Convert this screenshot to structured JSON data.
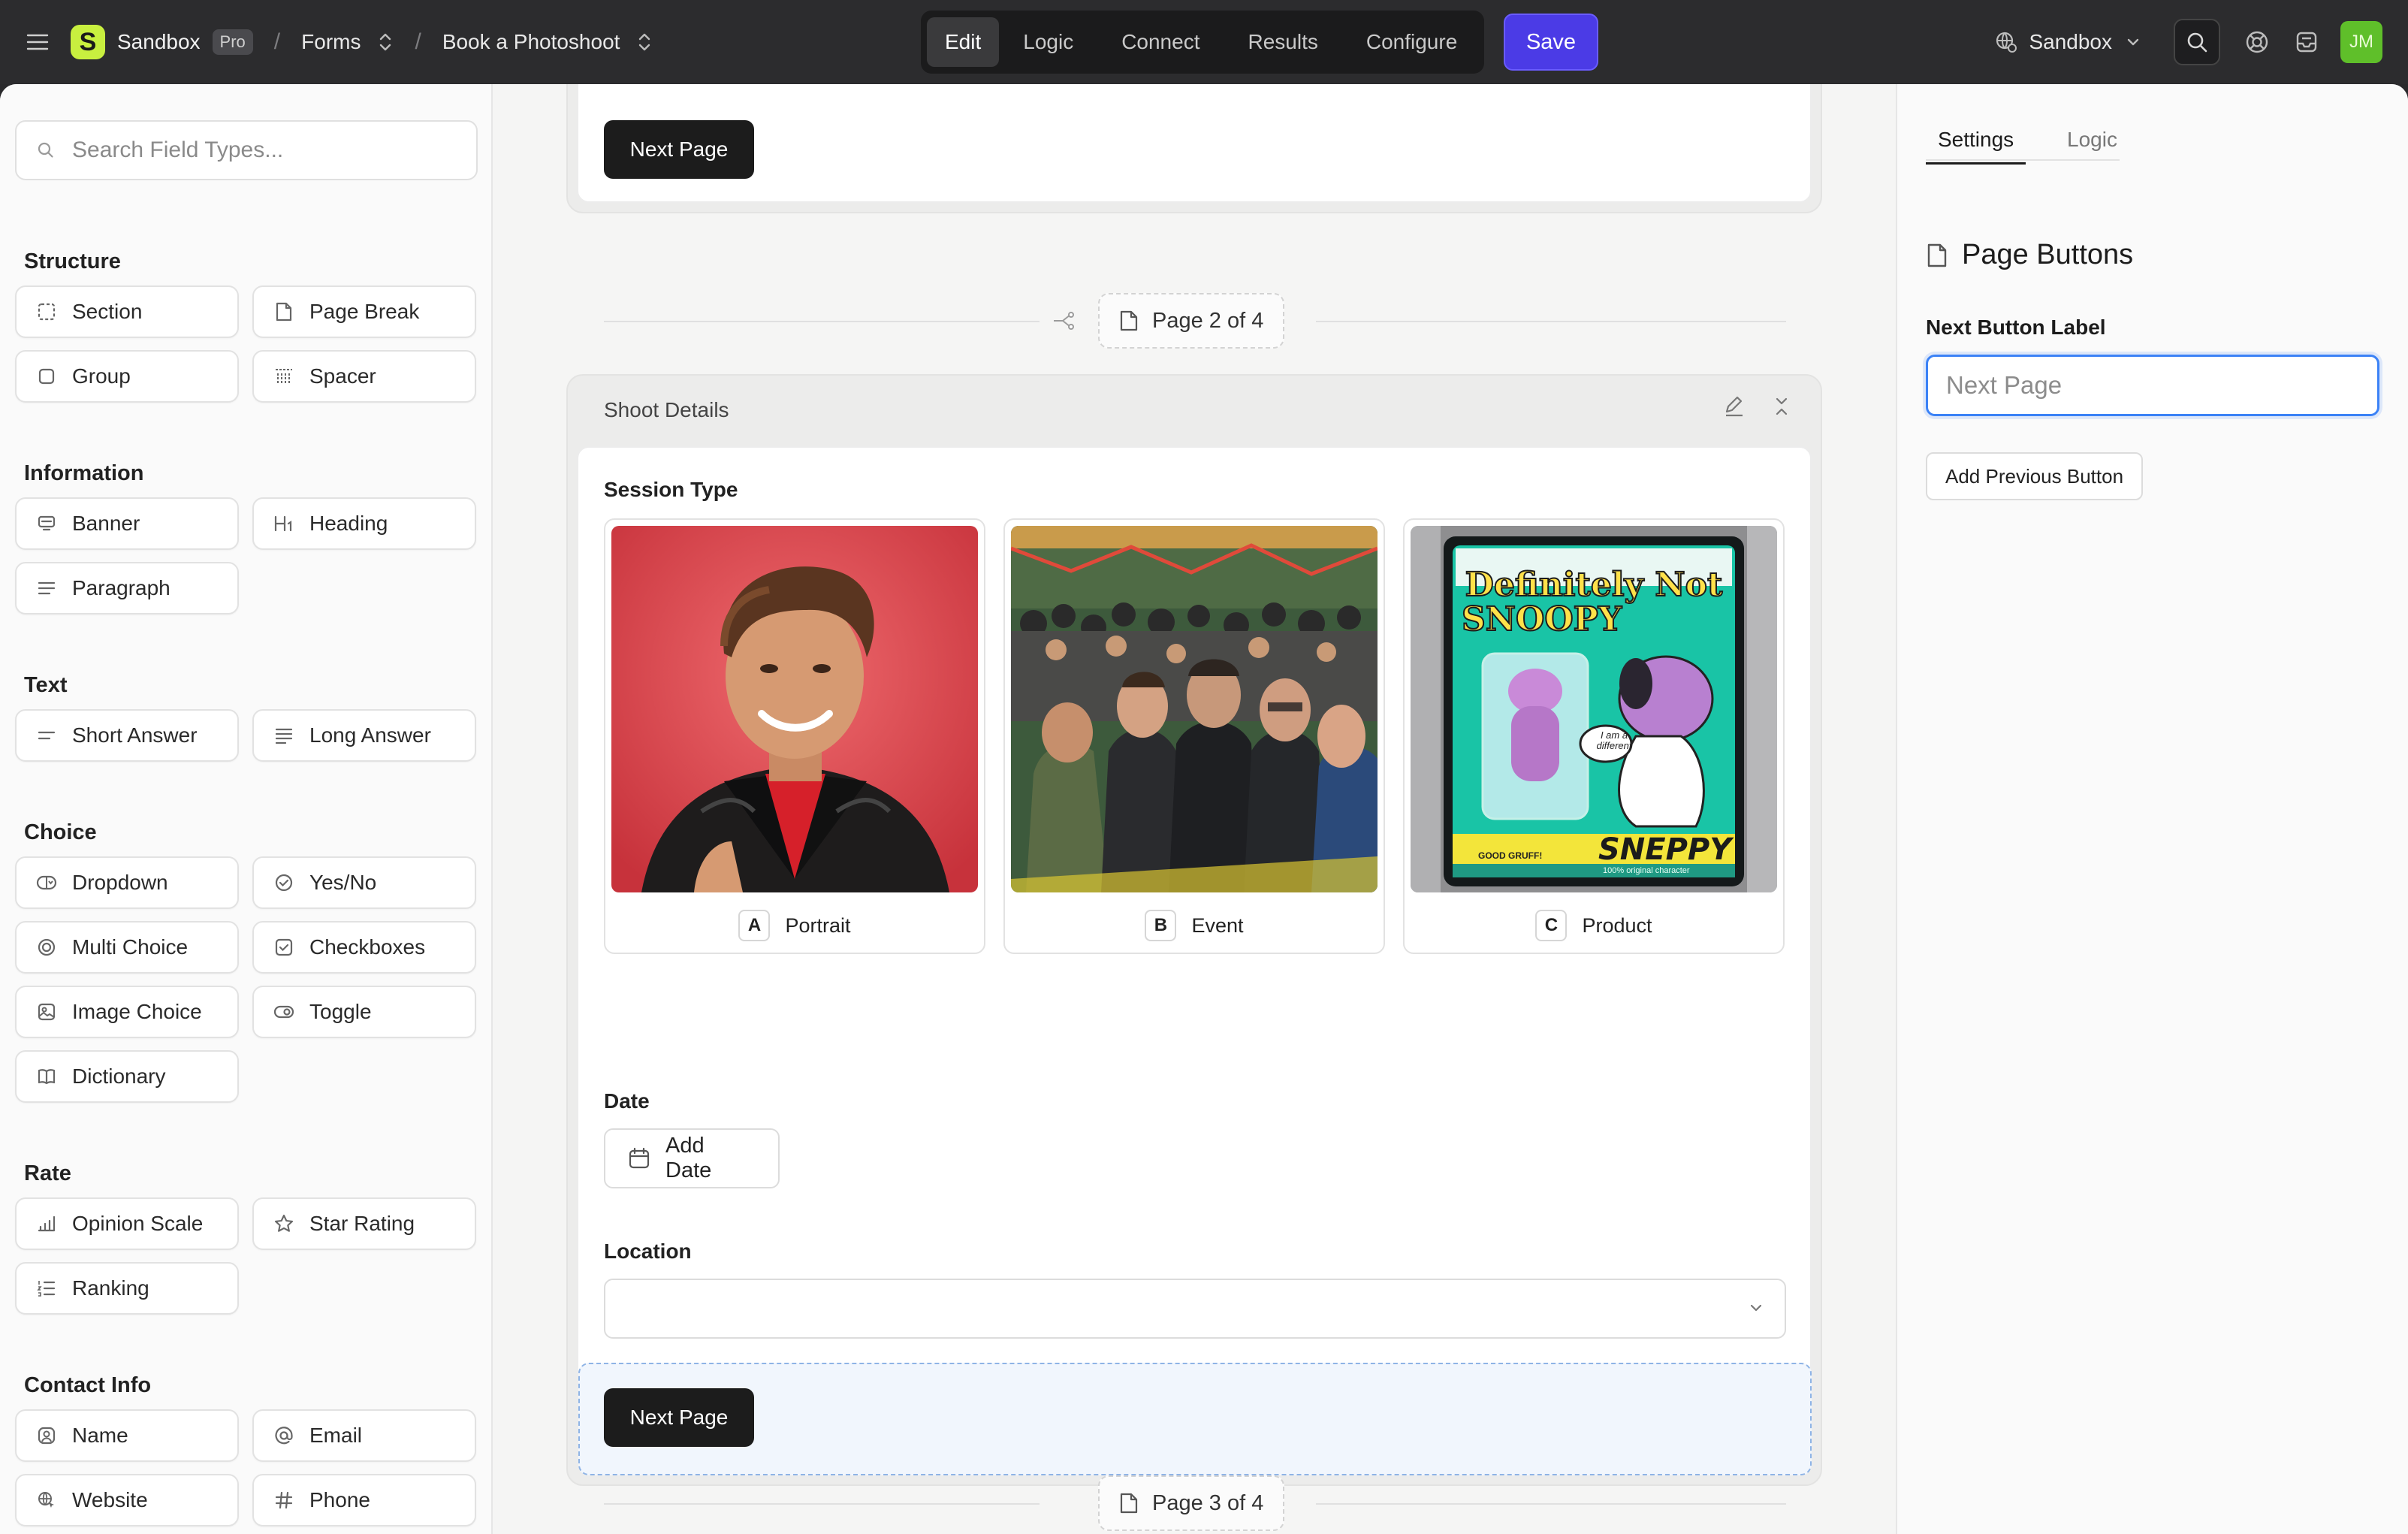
{
  "topbar": {
    "workspace_name": "Sandbox",
    "plan_badge": "Pro",
    "crumb_sep": "/",
    "breadcrumb_forms": "Forms",
    "breadcrumb_form": "Book a Photoshoot",
    "tabs": [
      {
        "label": "Edit"
      },
      {
        "label": "Logic"
      },
      {
        "label": "Connect"
      },
      {
        "label": "Results"
      },
      {
        "label": "Configure"
      }
    ],
    "save_label": "Save",
    "workspace_switch": "Sandbox",
    "avatar_initials": "JM",
    "accent_color": "#4b3be6"
  },
  "sidebar": {
    "search_placeholder": "Search Field Types...",
    "groups": {
      "structure": {
        "title": "Structure",
        "items": [
          "Section",
          "Page Break",
          "Group",
          "Spacer"
        ]
      },
      "information": {
        "title": "Information",
        "items": [
          "Banner",
          "Heading",
          "Paragraph"
        ]
      },
      "text": {
        "title": "Text",
        "items": [
          "Short Answer",
          "Long Answer"
        ]
      },
      "choice": {
        "title": "Choice",
        "items": [
          "Dropdown",
          "Yes/No",
          "Multi Choice",
          "Checkboxes",
          "Image Choice",
          "Toggle",
          "Dictionary"
        ]
      },
      "rate": {
        "title": "Rate",
        "items": [
          "Opinion Scale",
          "Star Rating",
          "Ranking"
        ]
      },
      "contact": {
        "title": "Contact Info",
        "items": [
          "Name",
          "Email",
          "Website",
          "Phone"
        ]
      }
    }
  },
  "canvas": {
    "prev_next_button": "Next Page",
    "page2_label": "Page 2 of 4",
    "section_title": "Shoot Details",
    "session_type_label": "Session Type",
    "choices": [
      {
        "key": "A",
        "label": "Portrait"
      },
      {
        "key": "B",
        "label": "Event"
      },
      {
        "key": "C",
        "label": "Product"
      }
    ],
    "product_art": {
      "title_line1": "Definitely Not",
      "title_line2": "SNOOPY",
      "bubble": "I am a different",
      "brand": "SNEPPY",
      "tag_left": "GOOD GRUFF!",
      "tag_right": "100% original character"
    },
    "date_label": "Date",
    "add_date_label": "Add Date",
    "location_label": "Location",
    "next_button": "Next Page",
    "page3_label": "Page 3 of 4"
  },
  "panel": {
    "tabs": [
      "Settings",
      "Logic"
    ],
    "title": "Page Buttons",
    "next_label_title": "Next Button Label",
    "next_label_placeholder": "Next Page",
    "add_previous_button": "Add Previous Button"
  }
}
